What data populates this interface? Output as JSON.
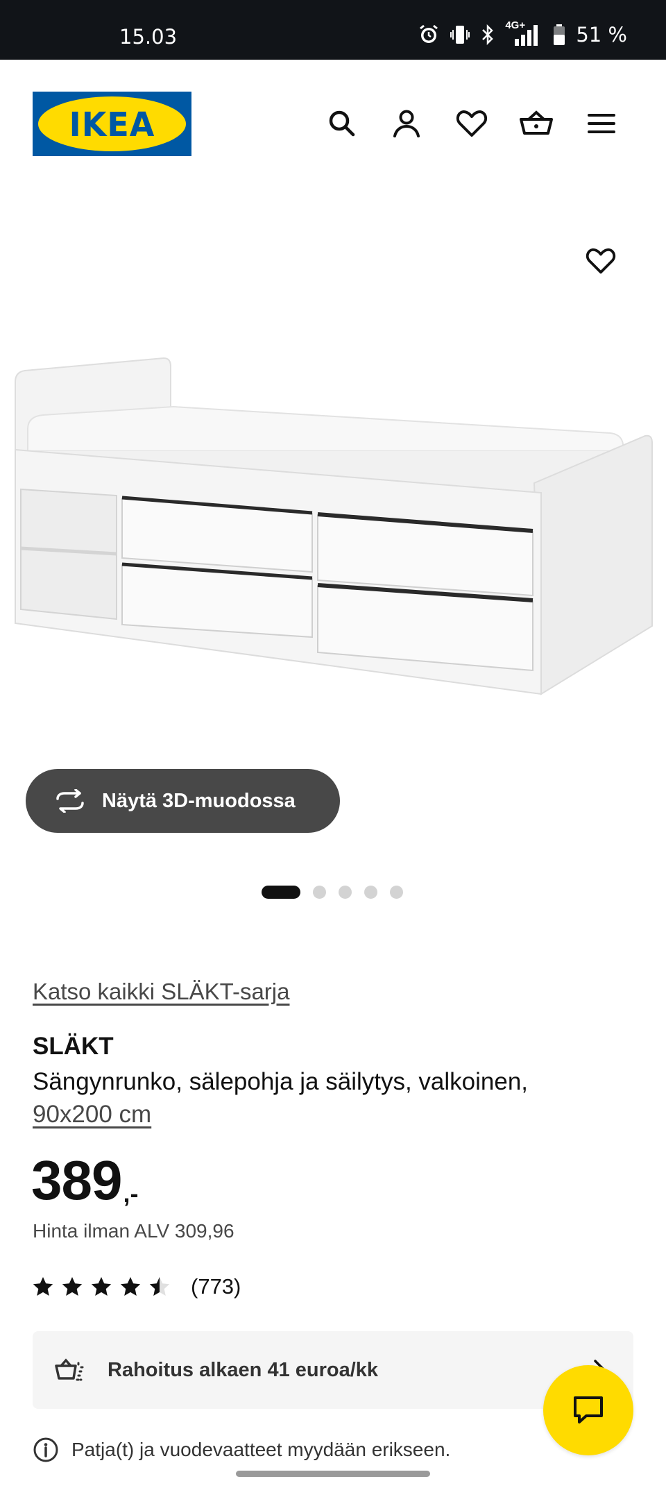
{
  "status_bar": {
    "time": "15.03",
    "network": "4G+",
    "battery": "51 %",
    "icons": [
      "alarm-icon",
      "vibrate-icon",
      "bluetooth-icon",
      "signal-icon",
      "battery-icon"
    ]
  },
  "header": {
    "logo": "IKEA",
    "icons": [
      "search-icon",
      "account-icon",
      "heart-icon",
      "basket-icon",
      "menu-icon"
    ]
  },
  "gallery": {
    "view_3d_label": "Näytä 3D-muodossa",
    "dots": 5,
    "active_dot": 1
  },
  "product": {
    "series_link": "Katso kaikki SLÄKT-sarja",
    "name": "SLÄKT",
    "description": "Sängynrunko, sälepohja ja säilytys, valkoinen,",
    "size": "90x200 cm",
    "price_integer": "389",
    "price_suffix": ",-",
    "price_vat": "Hinta ilman ALV 309,96",
    "rating_value": 4.5,
    "rating_count": "(773)"
  },
  "finance": {
    "label": "Rahoitus alkaen 41 euroa/kk"
  },
  "notice": {
    "text": "Patja(t) ja vuodevaatteet myydään erikseen."
  },
  "colors": {
    "ikea_blue": "#0058a3",
    "ikea_yellow": "#ffdb00",
    "dark_button": "#484848",
    "status_bar": "#111418"
  }
}
